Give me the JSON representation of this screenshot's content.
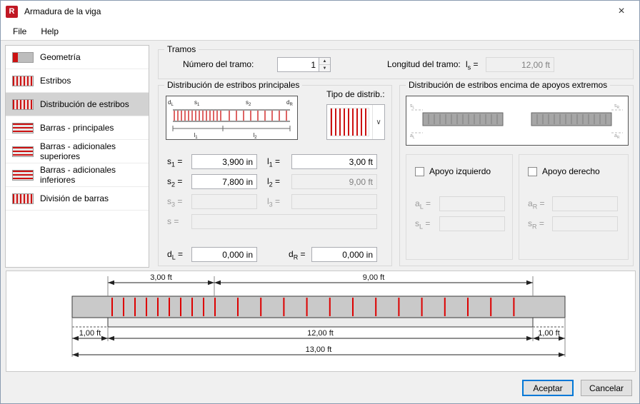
{
  "eq": "=",
  "window": {
    "title": "Armadura de la viga"
  },
  "icons": {
    "app": "R",
    "close": "×",
    "spin_up": "▲",
    "spin_down": "▼",
    "dropdown": "∨"
  },
  "menu": {
    "file": "File",
    "help": "Help"
  },
  "sidebar": {
    "items": [
      {
        "label": "Geometría"
      },
      {
        "label": "Estribos"
      },
      {
        "label": "Distribución de estribos"
      },
      {
        "label": "Barras - principales"
      },
      {
        "label": "Barras - adicionales superiores"
      },
      {
        "label": "Barras - adicionales inferiores"
      },
      {
        "label": "División de barras"
      }
    ]
  },
  "tramos": {
    "title": "Tramos",
    "numero_label": "Número del tramo:",
    "numero_value": "1",
    "longitud_label": "Longitud del tramo:",
    "sym": "l",
    "sub": "s",
    "value": "12,00 ft"
  },
  "principales": {
    "title": "Distribución de estribos principales",
    "tipo_label": "Tipo de distrib.:",
    "diagram": {
      "dl": "d",
      "dl_sub": "L",
      "s1": "s",
      "s1_sub": "1",
      "s2": "s",
      "s2_sub": "2",
      "dr": "d",
      "dr_sub": "R",
      "l1": "l",
      "l1_sub": "1",
      "l2": "l",
      "l2_sub": "2"
    },
    "s1": {
      "sym": "s",
      "sub": "1",
      "value": "3,900 in"
    },
    "s2": {
      "sym": "s",
      "sub": "2",
      "value": "7,800 in"
    },
    "s3": {
      "sym": "s",
      "sub": "3",
      "value": ""
    },
    "s": {
      "sym": "s",
      "sub": "",
      "value": ""
    },
    "l1": {
      "sym": "l",
      "sub": "1",
      "value": "3,00 ft"
    },
    "l2": {
      "sym": "l",
      "sub": "2",
      "value": "9,00 ft"
    },
    "l3": {
      "sym": "l",
      "sub": "3",
      "value": ""
    },
    "dl": {
      "sym": "d",
      "sub": "L",
      "value": "0,000 in"
    },
    "dr": {
      "sym": "d",
      "sub": "R",
      "value": "0,000 in"
    }
  },
  "apoyos": {
    "title": "Distribución de estribos encima de apoyos extremos",
    "left_checkbox": "Apoyo izquierdo",
    "right_checkbox": "Apoyo derecho",
    "al": {
      "sym": "a",
      "sub": "L",
      "value": ""
    },
    "sl": {
      "sym": "s",
      "sub": "L",
      "value": ""
    },
    "ar": {
      "sym": "a",
      "sub": "R",
      "value": ""
    },
    "sr": {
      "sym": "s",
      "sub": "R",
      "value": ""
    },
    "diagram": {
      "sl": "s",
      "sl_sub": "L",
      "al": "a",
      "al_sub": "L",
      "sr": "s",
      "sr_sub": "R",
      "ar": "a",
      "ar_sub": "R"
    }
  },
  "beam_diagram": {
    "dim_section_left": "3,00 ft",
    "dim_section_right": "9,00 ft",
    "dim_span": "12,00 ft",
    "dim_total": "13,00 ft",
    "dim_overhang_left": "1,00 ft",
    "dim_overhang_right": "1,00 ft"
  },
  "buttons": {
    "ok": "Aceptar",
    "cancel": "Cancelar"
  }
}
